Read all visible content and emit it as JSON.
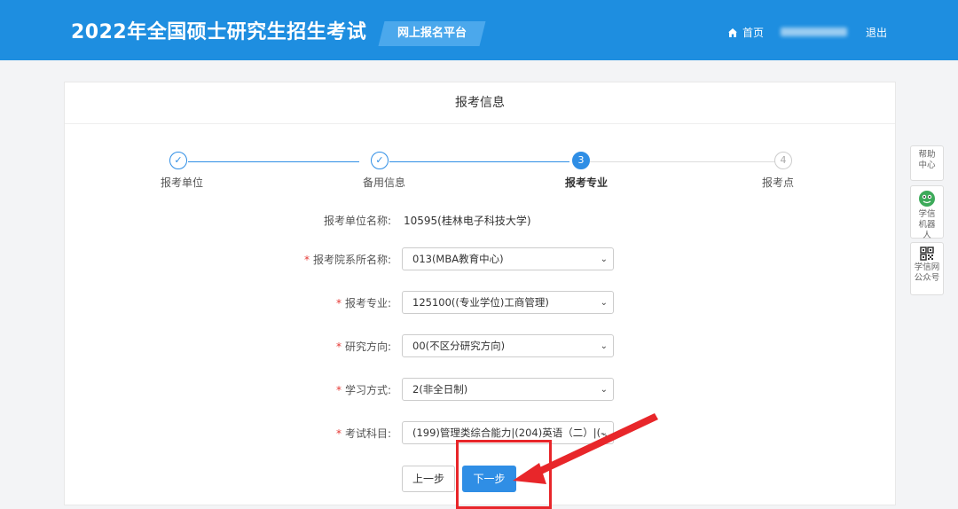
{
  "header": {
    "title": "2022年全国硕士研究生招生考试",
    "platform_label": "网上报名平台",
    "home_label": "首页",
    "logout_label": "退出"
  },
  "card": {
    "title": "报考信息"
  },
  "steps": [
    {
      "index": "1",
      "label": "报考单位",
      "state": "done"
    },
    {
      "index": "2",
      "label": "备用信息",
      "state": "done"
    },
    {
      "index": "3",
      "label": "报考专业",
      "state": "active"
    },
    {
      "index": "4",
      "label": "报考点",
      "state": "todo"
    }
  ],
  "form": {
    "unit": {
      "label": "报考单位名称:",
      "value": "10595(桂林电子科技大学)"
    },
    "department": {
      "label": "报考院系所名称:",
      "value": "013(MBA教育中心)"
    },
    "major": {
      "label": "报考专业:",
      "value": "125100((专业学位)工商管理)"
    },
    "direction": {
      "label": "研究方向:",
      "value": "00(不区分研究方向)"
    },
    "study_mode": {
      "label": "学习方式:",
      "value": "2(非全日制)"
    },
    "subjects": {
      "label": "考试科目:",
      "value": "(199)管理类综合能力|(204)英语（二）|(-..."
    },
    "required_mark": "*"
  },
  "buttons": {
    "prev": "上一步",
    "next": "下一步"
  },
  "side": {
    "help": "帮助中心",
    "robot": "学信机器人",
    "qr": "学信网公众号"
  },
  "colors": {
    "header_bg": "#1e8ee0",
    "primary": "#2f8ee5",
    "annotation_red": "#e8262a"
  }
}
